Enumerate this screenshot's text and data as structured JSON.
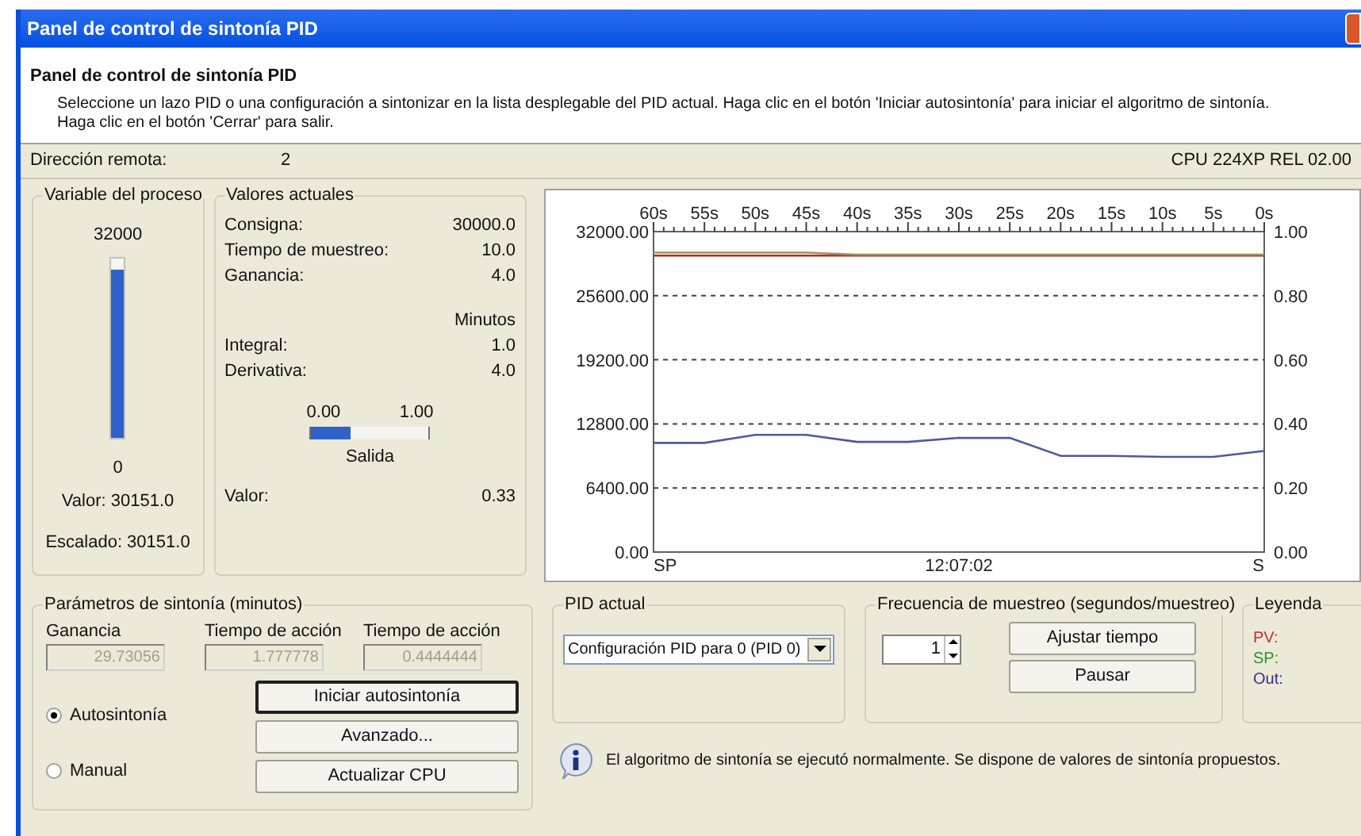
{
  "window": {
    "title": "Panel de control de sintonía PID"
  },
  "header": {
    "title": "Panel de control de sintonía PID",
    "description": "Seleccione un lazo PID o una configuración a sintonizar en la lista desplegable del PID actual. Haga clic en el botón 'Iniciar autosintonía' para iniciar el algoritmo de sintonía.",
    "description_2": "Haga clic en el botón 'Cerrar' para salir."
  },
  "info_bar": {
    "label": "Dirección remota:",
    "value": "2",
    "cpu": "CPU 224XP REL 02.00"
  },
  "process_variable": {
    "title": "Variable del proceso",
    "max": "32000",
    "min": "0",
    "level": 0.94,
    "value": "Valor: 30151.0",
    "scaled": "Escalado: 30151.0"
  },
  "current_values": {
    "title": "Valores actuales",
    "rows": [
      {
        "label": "Consigna:",
        "value": "30000.0"
      },
      {
        "label": "Tiempo de muestreo:",
        "value": "10.0"
      },
      {
        "label": "Ganancia:",
        "value": "4.0"
      }
    ],
    "unit": "Minutos",
    "rows_2": [
      {
        "label": "Integral:",
        "value": "1.0"
      },
      {
        "label": "Derivativa:",
        "value": "4.0"
      }
    ],
    "output": {
      "min": "0.00",
      "max": "1.00",
      "level": 0.33,
      "label": "Salida"
    },
    "value_label": "Valor:",
    "value": "0.33"
  },
  "chart_data": {
    "type": "line",
    "x": [
      60,
      55,
      50,
      45,
      40,
      35,
      30,
      25,
      20,
      15,
      10,
      5,
      0
    ],
    "xticks": [
      {
        "value": 60,
        "label": "60s"
      },
      {
        "value": 55,
        "label": "55s"
      },
      {
        "value": 50,
        "label": "50s"
      },
      {
        "value": 45,
        "label": "45s"
      },
      {
        "value": 40,
        "label": "40s"
      },
      {
        "value": 35,
        "label": "35s"
      },
      {
        "value": 30,
        "label": "30s"
      },
      {
        "value": 25,
        "label": "25s"
      },
      {
        "value": 20,
        "label": "20s"
      },
      {
        "value": 15,
        "label": "15s"
      },
      {
        "value": 10,
        "label": "10s"
      },
      {
        "value": 5,
        "label": "5s"
      },
      {
        "value": 0,
        "label": "0s"
      }
    ],
    "xlim": [
      60,
      0
    ],
    "ylim": [
      0,
      32000
    ],
    "yticks": [
      {
        "value": 0,
        "label": "0.00"
      },
      {
        "value": 6400,
        "label": "6400.00"
      },
      {
        "value": 12800,
        "label": "12800.00"
      },
      {
        "value": 19200,
        "label": "19200.00"
      },
      {
        "value": 25600,
        "label": "25600.00"
      },
      {
        "value": 32000,
        "label": "32000.00"
      }
    ],
    "y2lim": [
      0,
      1
    ],
    "grid": true,
    "y2ticks": [
      {
        "value": 0,
        "label": "0.00"
      },
      {
        "value": 0.2,
        "label": "0.20"
      },
      {
        "value": 0.4,
        "label": "0.40"
      },
      {
        "value": 0.6,
        "label": "0.60"
      },
      {
        "value": 0.8,
        "label": "0.80"
      },
      {
        "value": 1,
        "label": "1.00"
      }
    ],
    "series": [
      {
        "name": "PV:",
        "color": "#b03020",
        "values": [
          29600,
          29600,
          29600,
          29600,
          29600,
          29600,
          29600,
          29600,
          29600,
          29600,
          29600,
          29600,
          29600
        ]
      },
      {
        "name": "SP:",
        "color": "#a09060",
        "values": [
          29900,
          29900,
          29900,
          29900,
          29700,
          29700,
          29700,
          29700,
          29700,
          29700,
          29700,
          29700,
          29700
        ]
      },
      {
        "name": "Out:",
        "color": "#5058a0",
        "values": [
          10900,
          10900,
          11700,
          11700,
          11000,
          11000,
          11400,
          11400,
          9600,
          9600,
          9500,
          9500,
          10100
        ]
      }
    ]
  },
  "chart_footer": [
    "SP",
    "12:07:02",
    "S"
  ],
  "tuning": {
    "title": "Parámetros de sintonía (minutos)",
    "fields": [
      {
        "label": "Ganancia",
        "value": "29.73056",
        "disabled": true
      },
      {
        "label": "Tiempo de acción",
        "value": "1.777778",
        "disabled": true
      },
      {
        "label": "Tiempo de acción",
        "value": "0.4444444",
        "disabled": true
      }
    ],
    "modes": [
      {
        "label": "Autosintonía",
        "selected": true
      },
      {
        "label": "Manual",
        "selected": false
      }
    ],
    "buttons": [
      {
        "label": "Iniciar autosintonía",
        "default": true
      },
      {
        "label": "Avanzado...",
        "default": false
      },
      {
        "label": "Actualizar CPU",
        "default": false
      }
    ]
  },
  "pid": {
    "title": "PID actual",
    "value": "Configuración PID para 0 (PID 0)"
  },
  "sampling": {
    "title": "Frecuencia de muestreo (segundos/muestreo)",
    "value": "1",
    "buttons": [
      "Ajustar tiempo",
      "Pausar"
    ]
  },
  "legend": {
    "title": "Leyenda",
    "items": [
      {
        "color": "#c03030"
      },
      {
        "color": "#309030"
      },
      {
        "color": "#303090"
      }
    ]
  },
  "message": "El algoritmo de sintonía se ejecutó normalmente. Se dispone de valores de sintonía propuestos."
}
